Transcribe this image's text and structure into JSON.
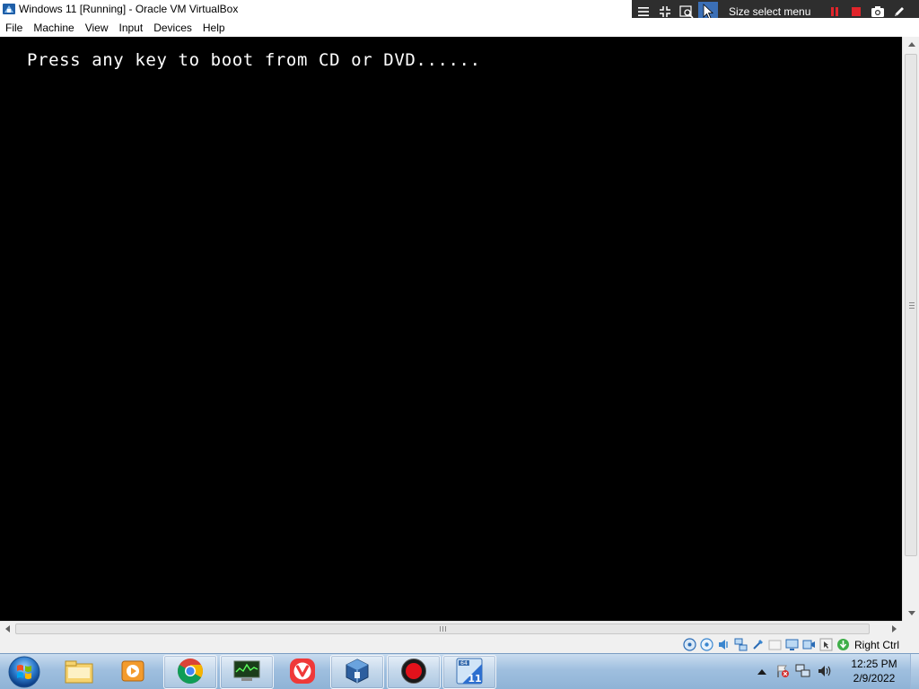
{
  "window": {
    "title": "Windows 11 [Running] - Oracle VM VirtualBox"
  },
  "minitoolbar": {
    "size_select_label": "Size select menu",
    "icons": [
      "menu-icon",
      "exit-fullscreen-icon",
      "scale-icon",
      "pointer-icon",
      "pause-icon",
      "stop-icon",
      "camera-icon",
      "pen-icon"
    ]
  },
  "menubar": {
    "items": [
      "File",
      "Machine",
      "View",
      "Input",
      "Devices",
      "Help"
    ]
  },
  "vm": {
    "boot_message": "Press any key to boot from CD or DVD......"
  },
  "statusbar": {
    "host_key": "Right Ctrl",
    "icons": [
      "hard-disk-icon",
      "optical-drive-icon",
      "audio-icon",
      "network-icon",
      "usb-icon",
      "shared-folder-icon",
      "display-icon",
      "video-capture-icon",
      "mouse-integration-icon",
      "keyboard-icon"
    ]
  },
  "taskbar": {
    "apps": [
      "windows-explorer",
      "media-player",
      "google-chrome",
      "system-monitor",
      "vivaldi",
      "virtualbox",
      "screen-recorder",
      "windows-11-vm"
    ],
    "clock_time": "12:25 PM",
    "clock_date": "2/9/2022"
  },
  "colors": {
    "vm_background": "#000000",
    "boot_text": "#ffffff",
    "minitoolbar_bg": "#2e2e2e",
    "minitoolbar_active": "#3b6fb6",
    "taskbar_top": "#c9dcef",
    "taskbar_bottom": "#8fb3d6",
    "pause_stop_red": "#e0252b"
  }
}
